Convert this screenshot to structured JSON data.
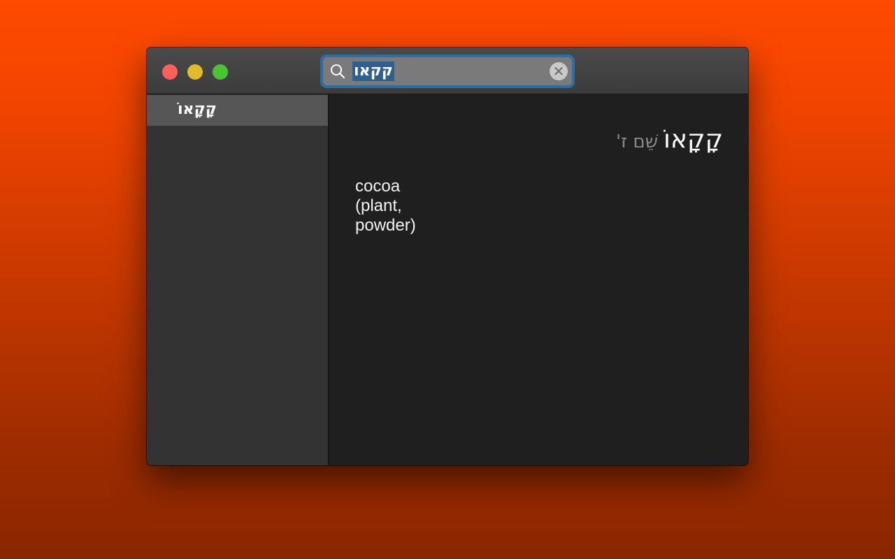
{
  "window": {
    "traffic_lights": {
      "close_color": "#fe5f57",
      "minimize_color": "#e4b92a",
      "maximize_color": "#4bc432"
    }
  },
  "search": {
    "value": "קקאו",
    "icon": "search-icon",
    "clear_icon": "close-circle-icon",
    "clear_glyph": "✕"
  },
  "sidebar": {
    "items": [
      {
        "label": "קָקָאוֹ",
        "selected": true
      }
    ]
  },
  "entry": {
    "headword": "קָקָאוֹ",
    "part_of_speech": "שֵׁם ז'",
    "definition": "cocoa (plant, powder)"
  },
  "colors": {
    "desktop_top": "#ff4a00",
    "desktop_bottom": "#8a2600",
    "focus_ring": "#2d6fa5",
    "selection": "#2f5f8e"
  }
}
